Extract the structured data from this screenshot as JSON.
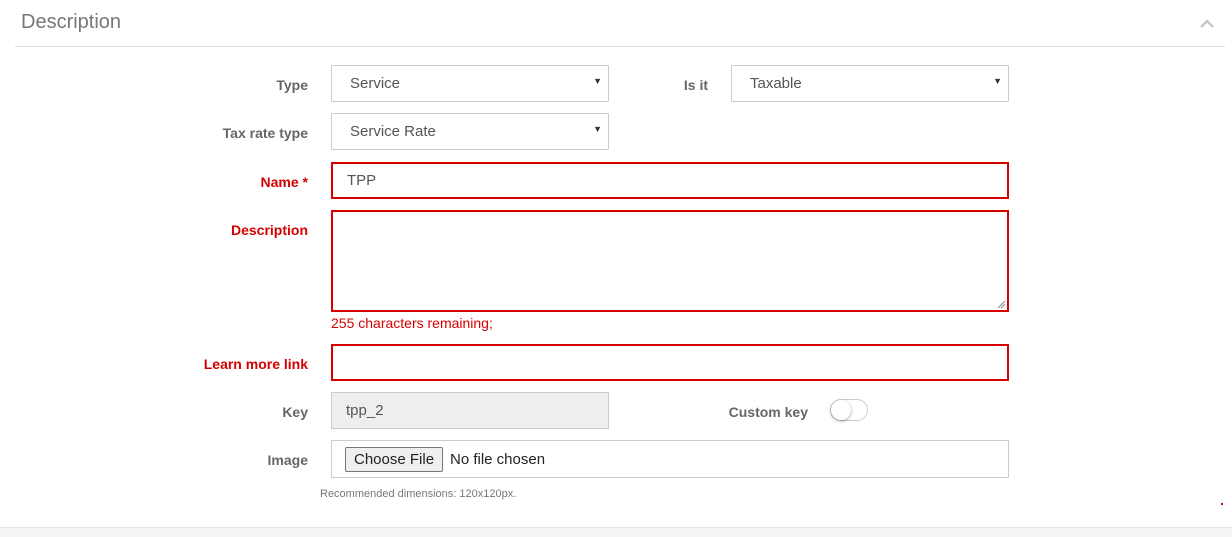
{
  "panel": {
    "title": "Description",
    "collapse_icon": "chevron-up-icon"
  },
  "form": {
    "type": {
      "label": "Type",
      "value": "Service"
    },
    "is_it": {
      "label": "Is it",
      "value": "Taxable"
    },
    "tax_rate_type": {
      "label": "Tax rate type",
      "value": "Service Rate"
    },
    "name": {
      "label": "Name *",
      "value": "TPP"
    },
    "description": {
      "label": "Description",
      "value": "",
      "helper": "255 characters remaining;"
    },
    "learn_more_link": {
      "label": "Learn more link",
      "value": ""
    },
    "key": {
      "label": "Key",
      "value": "tpp_2"
    },
    "custom_key": {
      "label": "Custom key",
      "enabled": false
    },
    "image": {
      "label": "Image",
      "button_label": "Choose File",
      "status": "No file chosen",
      "hint": "Recommended dimensions: 120x120px."
    }
  },
  "colors": {
    "error": "#d60000",
    "border": "#cccccc",
    "readonly_bg": "#eeeeee"
  }
}
